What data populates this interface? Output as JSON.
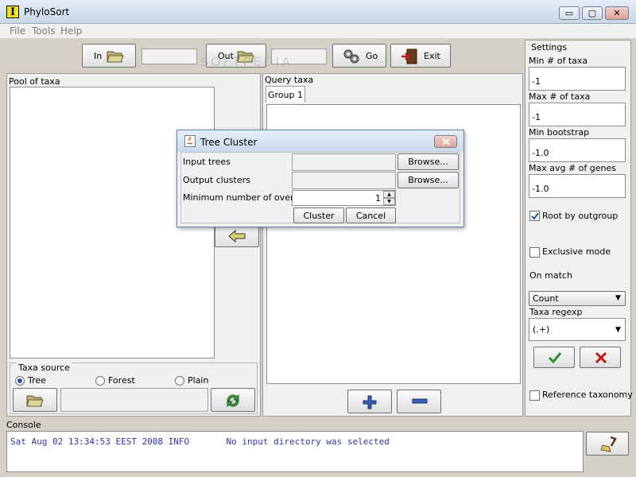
{
  "window": {
    "title": "PhyloSort",
    "app_icon_letter": "I",
    "minimize": "▭",
    "maximize": "▢",
    "close": "✕"
  },
  "menu": {
    "items": [
      "File",
      "Tools",
      "Help"
    ]
  },
  "toolbar": {
    "in_label": "In",
    "out_label": "Out",
    "go_label": "Go",
    "exit_label": "Exit"
  },
  "pool": {
    "title": "Pool of taxa"
  },
  "query": {
    "title": "Query taxa",
    "tab": "Group 1"
  },
  "taxa_source": {
    "title": "Taxa source",
    "tree": "Tree",
    "forest": "Forest",
    "plain": "Plain",
    "selected": "Tree"
  },
  "settings": {
    "title": "Settings",
    "min_taxa_label": "Min # of taxa",
    "min_taxa": "-1",
    "max_taxa_label": "Max # of taxa",
    "max_taxa": "-1",
    "min_bootstrap_label": "Min bootstrap",
    "min_bootstrap": "-1.0",
    "max_genes_label": "Max avg # of genes",
    "max_genes": "-1.0",
    "root_outgroup_label": "Root by outgroup",
    "root_outgroup_checked": true,
    "exclusive_label": "Exclusive mode",
    "on_match_label": "On match",
    "on_match_value": "Count",
    "regexp_label": "Taxa regexp",
    "regexp_value": "(.+)",
    "reference_label": "Reference taxonomy"
  },
  "console": {
    "title": "Console",
    "line": "Sat Aug 02 13:34:53 EEST 2008 INFO       No input directory was selected"
  },
  "dialog": {
    "title": "Tree Cluster",
    "input_trees_label": "Input trees",
    "output_clusters_label": "Output clusters",
    "min_overlaps_label": "Minimum number of overlaps",
    "min_overlaps_value": "1",
    "browse1": "Browse...",
    "browse2": "Browse...",
    "cluster": "Cluster",
    "cancel": "Cancel"
  },
  "watermark": "SOFTPEDIA",
  "colors": {
    "console_text": "#2a36b0",
    "confirm_green": "#2f8f2f",
    "cancel_red": "#c01818"
  }
}
